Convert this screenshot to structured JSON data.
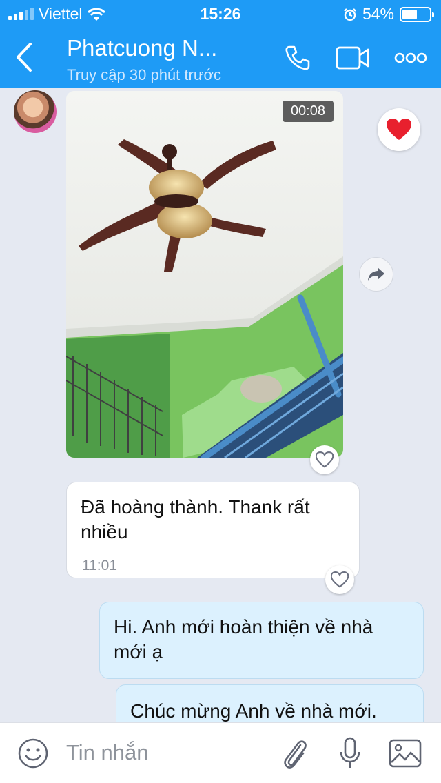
{
  "status_bar": {
    "carrier": "Viettel",
    "time": "15:26",
    "battery": "54%",
    "battery_level": 0.54
  },
  "header": {
    "contact_name": "Phatcuong N...",
    "contact_status": "Truy cập 30 phút trước",
    "icons": [
      "back-arrow-icon",
      "phone-icon",
      "video-call-icon",
      "more-dots-icon"
    ]
  },
  "chat": {
    "video": {
      "duration": "00:08"
    },
    "messages": [
      {
        "direction": "in",
        "lines": [
          "Đã hoàng thành. Thank rất",
          "nhiều"
        ],
        "time": "11:01"
      },
      {
        "direction": "out",
        "lines": [
          "Hi. Anh mới hoàn thiện về nhà",
          "mới ạ"
        ]
      },
      {
        "direction": "out",
        "lines": [
          "Chúc mừng Anh về nhà mới."
        ]
      }
    ]
  },
  "composer": {
    "placeholder": "Tin nhắn",
    "icons": [
      "emoji-icon",
      "attachment-icon",
      "microphone-icon",
      "image-icon"
    ]
  },
  "colors": {
    "header_bg": "#1e9bf6",
    "chat_bg": "#e5e9f2",
    "outgoing_bubble": "#dcf1fe",
    "heart": "#e8202e"
  }
}
